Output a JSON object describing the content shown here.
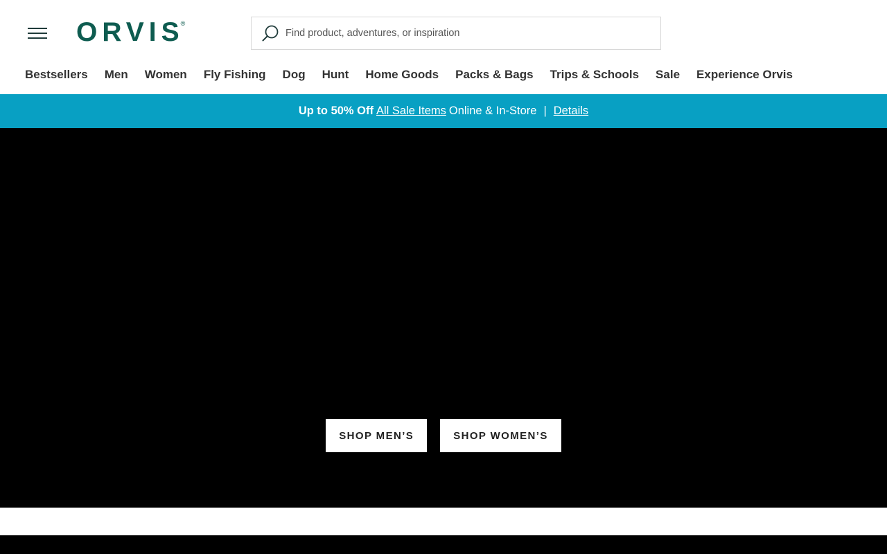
{
  "header": {
    "logo_text": "ORVIS",
    "logo_mark": "®",
    "menu_icon": "hamburger-menu-icon",
    "search": {
      "icon": "search-icon",
      "placeholder": "Find product, adventures, or inspiration",
      "value": ""
    }
  },
  "nav": {
    "items": [
      {
        "label": "Bestsellers"
      },
      {
        "label": "Men"
      },
      {
        "label": "Women"
      },
      {
        "label": "Fly Fishing"
      },
      {
        "label": "Dog"
      },
      {
        "label": "Hunt"
      },
      {
        "label": "Home Goods"
      },
      {
        "label": "Packs & Bags"
      },
      {
        "label": "Trips & Schools"
      },
      {
        "label": "Sale"
      },
      {
        "label": "Experience Orvis"
      }
    ]
  },
  "promo": {
    "headline": "Up to 50% Off",
    "link_label": "All Sale Items",
    "suffix": "Online & In-Store",
    "separator": "|",
    "details_label": "Details"
  },
  "hero": {
    "buttons": [
      {
        "label": "SHOP MEN’S"
      },
      {
        "label": "SHOP WOMEN’S"
      }
    ]
  },
  "colors": {
    "brand": "#0e5c50",
    "promo_bg": "#08a0c3",
    "hero_bg": "#000000"
  }
}
